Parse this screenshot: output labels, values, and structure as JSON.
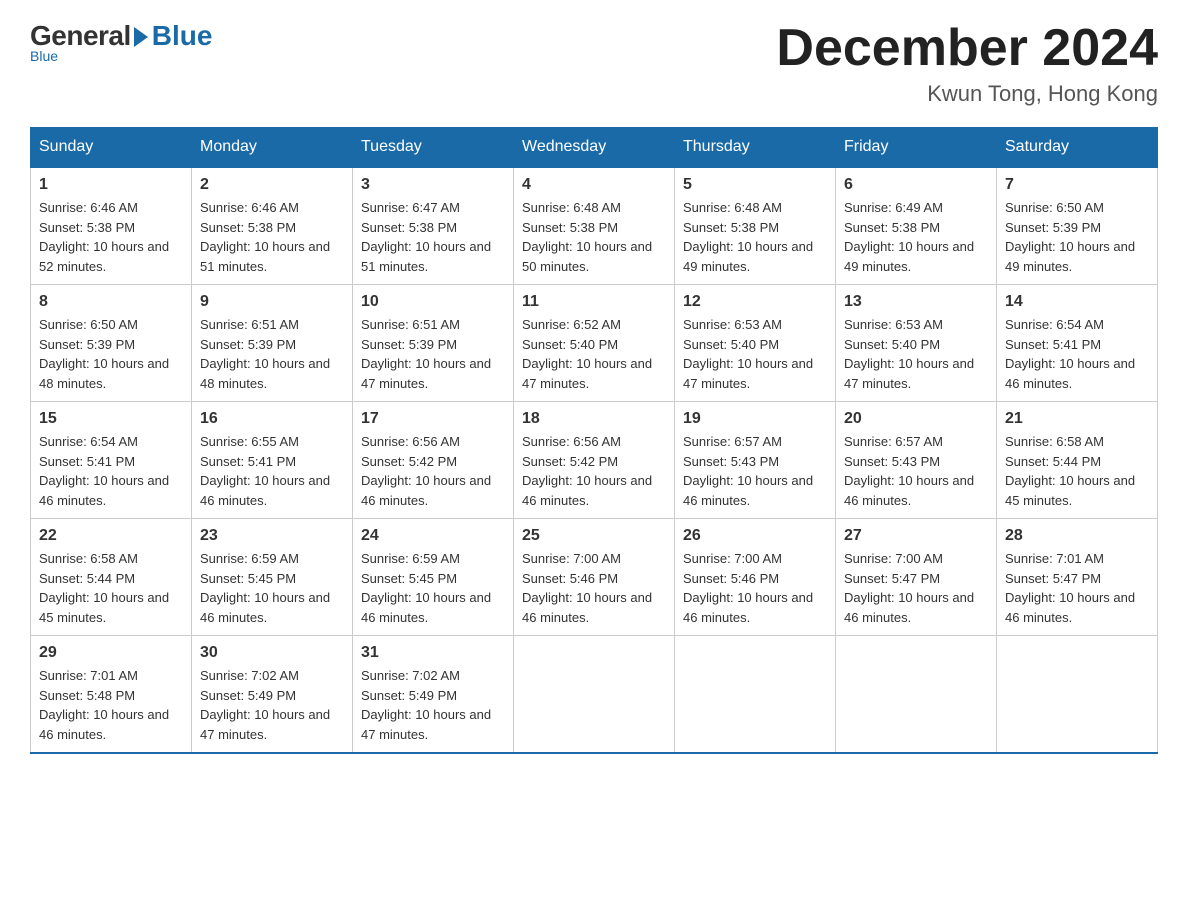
{
  "logo": {
    "general": "General",
    "blue": "Blue",
    "subtitle": "Blue"
  },
  "title": {
    "month_year": "December 2024",
    "location": "Kwun Tong, Hong Kong"
  },
  "headers": [
    "Sunday",
    "Monday",
    "Tuesday",
    "Wednesday",
    "Thursday",
    "Friday",
    "Saturday"
  ],
  "weeks": [
    [
      {
        "day": "1",
        "sunrise": "6:46 AM",
        "sunset": "5:38 PM",
        "daylight": "10 hours and 52 minutes."
      },
      {
        "day": "2",
        "sunrise": "6:46 AM",
        "sunset": "5:38 PM",
        "daylight": "10 hours and 51 minutes."
      },
      {
        "day": "3",
        "sunrise": "6:47 AM",
        "sunset": "5:38 PM",
        "daylight": "10 hours and 51 minutes."
      },
      {
        "day": "4",
        "sunrise": "6:48 AM",
        "sunset": "5:38 PM",
        "daylight": "10 hours and 50 minutes."
      },
      {
        "day": "5",
        "sunrise": "6:48 AM",
        "sunset": "5:38 PM",
        "daylight": "10 hours and 49 minutes."
      },
      {
        "day": "6",
        "sunrise": "6:49 AM",
        "sunset": "5:38 PM",
        "daylight": "10 hours and 49 minutes."
      },
      {
        "day": "7",
        "sunrise": "6:50 AM",
        "sunset": "5:39 PM",
        "daylight": "10 hours and 49 minutes."
      }
    ],
    [
      {
        "day": "8",
        "sunrise": "6:50 AM",
        "sunset": "5:39 PM",
        "daylight": "10 hours and 48 minutes."
      },
      {
        "day": "9",
        "sunrise": "6:51 AM",
        "sunset": "5:39 PM",
        "daylight": "10 hours and 48 minutes."
      },
      {
        "day": "10",
        "sunrise": "6:51 AM",
        "sunset": "5:39 PM",
        "daylight": "10 hours and 47 minutes."
      },
      {
        "day": "11",
        "sunrise": "6:52 AM",
        "sunset": "5:40 PM",
        "daylight": "10 hours and 47 minutes."
      },
      {
        "day": "12",
        "sunrise": "6:53 AM",
        "sunset": "5:40 PM",
        "daylight": "10 hours and 47 minutes."
      },
      {
        "day": "13",
        "sunrise": "6:53 AM",
        "sunset": "5:40 PM",
        "daylight": "10 hours and 47 minutes."
      },
      {
        "day": "14",
        "sunrise": "6:54 AM",
        "sunset": "5:41 PM",
        "daylight": "10 hours and 46 minutes."
      }
    ],
    [
      {
        "day": "15",
        "sunrise": "6:54 AM",
        "sunset": "5:41 PM",
        "daylight": "10 hours and 46 minutes."
      },
      {
        "day": "16",
        "sunrise": "6:55 AM",
        "sunset": "5:41 PM",
        "daylight": "10 hours and 46 minutes."
      },
      {
        "day": "17",
        "sunrise": "6:56 AM",
        "sunset": "5:42 PM",
        "daylight": "10 hours and 46 minutes."
      },
      {
        "day": "18",
        "sunrise": "6:56 AM",
        "sunset": "5:42 PM",
        "daylight": "10 hours and 46 minutes."
      },
      {
        "day": "19",
        "sunrise": "6:57 AM",
        "sunset": "5:43 PM",
        "daylight": "10 hours and 46 minutes."
      },
      {
        "day": "20",
        "sunrise": "6:57 AM",
        "sunset": "5:43 PM",
        "daylight": "10 hours and 46 minutes."
      },
      {
        "day": "21",
        "sunrise": "6:58 AM",
        "sunset": "5:44 PM",
        "daylight": "10 hours and 45 minutes."
      }
    ],
    [
      {
        "day": "22",
        "sunrise": "6:58 AM",
        "sunset": "5:44 PM",
        "daylight": "10 hours and 45 minutes."
      },
      {
        "day": "23",
        "sunrise": "6:59 AM",
        "sunset": "5:45 PM",
        "daylight": "10 hours and 46 minutes."
      },
      {
        "day": "24",
        "sunrise": "6:59 AM",
        "sunset": "5:45 PM",
        "daylight": "10 hours and 46 minutes."
      },
      {
        "day": "25",
        "sunrise": "7:00 AM",
        "sunset": "5:46 PM",
        "daylight": "10 hours and 46 minutes."
      },
      {
        "day": "26",
        "sunrise": "7:00 AM",
        "sunset": "5:46 PM",
        "daylight": "10 hours and 46 minutes."
      },
      {
        "day": "27",
        "sunrise": "7:00 AM",
        "sunset": "5:47 PM",
        "daylight": "10 hours and 46 minutes."
      },
      {
        "day": "28",
        "sunrise": "7:01 AM",
        "sunset": "5:47 PM",
        "daylight": "10 hours and 46 minutes."
      }
    ],
    [
      {
        "day": "29",
        "sunrise": "7:01 AM",
        "sunset": "5:48 PM",
        "daylight": "10 hours and 46 minutes."
      },
      {
        "day": "30",
        "sunrise": "7:02 AM",
        "sunset": "5:49 PM",
        "daylight": "10 hours and 47 minutes."
      },
      {
        "day": "31",
        "sunrise": "7:02 AM",
        "sunset": "5:49 PM",
        "daylight": "10 hours and 47 minutes."
      },
      null,
      null,
      null,
      null
    ]
  ]
}
